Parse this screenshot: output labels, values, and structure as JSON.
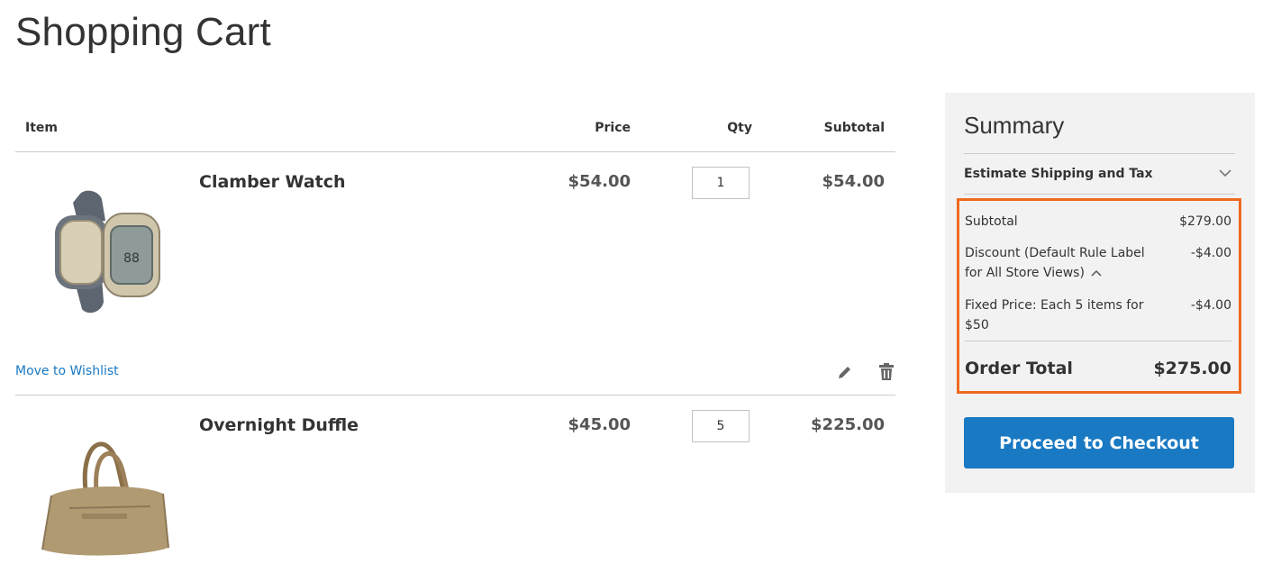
{
  "page": {
    "title": "Shopping Cart"
  },
  "cart": {
    "headers": {
      "item": "Item",
      "price": "Price",
      "qty": "Qty",
      "subtotal": "Subtotal"
    },
    "items": [
      {
        "name": "Clamber Watch",
        "price": "$54.00",
        "qty": "1",
        "subtotal": "$54.00",
        "image_icon": "watch-image"
      },
      {
        "name": "Overnight Duffle",
        "price": "$45.00",
        "qty": "5",
        "subtotal": "$225.00",
        "image_icon": "duffle-bag-image"
      }
    ],
    "actions": {
      "wishlist_label": "Move to Wishlist",
      "edit_icon": "pencil-icon",
      "delete_icon": "trash-icon"
    }
  },
  "summary": {
    "title": "Summary",
    "estimate_label": "Estimate Shipping and Tax",
    "subtotal_label": "Subtotal",
    "subtotal_value": "$279.00",
    "discount_label": "Discount (Default Rule Label for All Store Views)",
    "discount_value": "-$4.00",
    "fixed_label": "Fixed Price: Each 5 items for $50",
    "fixed_value": "-$4.00",
    "total_label": "Order Total",
    "total_value": "$275.00",
    "checkout_label": "Proceed to Checkout",
    "highlight_color": "#ef6a1f",
    "button_color": "#1979c3"
  }
}
